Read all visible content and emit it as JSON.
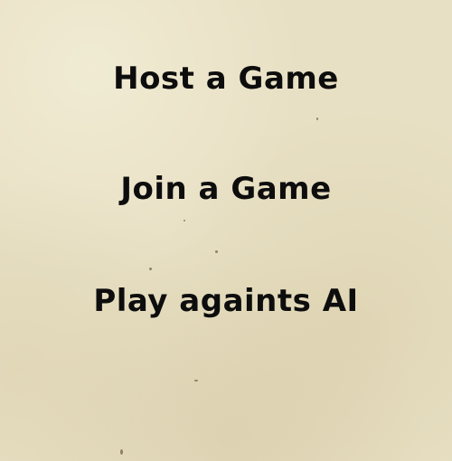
{
  "menu": {
    "items": [
      {
        "label": "Host a Game"
      },
      {
        "label": "Join a Game"
      },
      {
        "label": "Play againts AI"
      }
    ]
  },
  "colors": {
    "background": "#e8e0c4",
    "text": "#0d0d0d"
  }
}
